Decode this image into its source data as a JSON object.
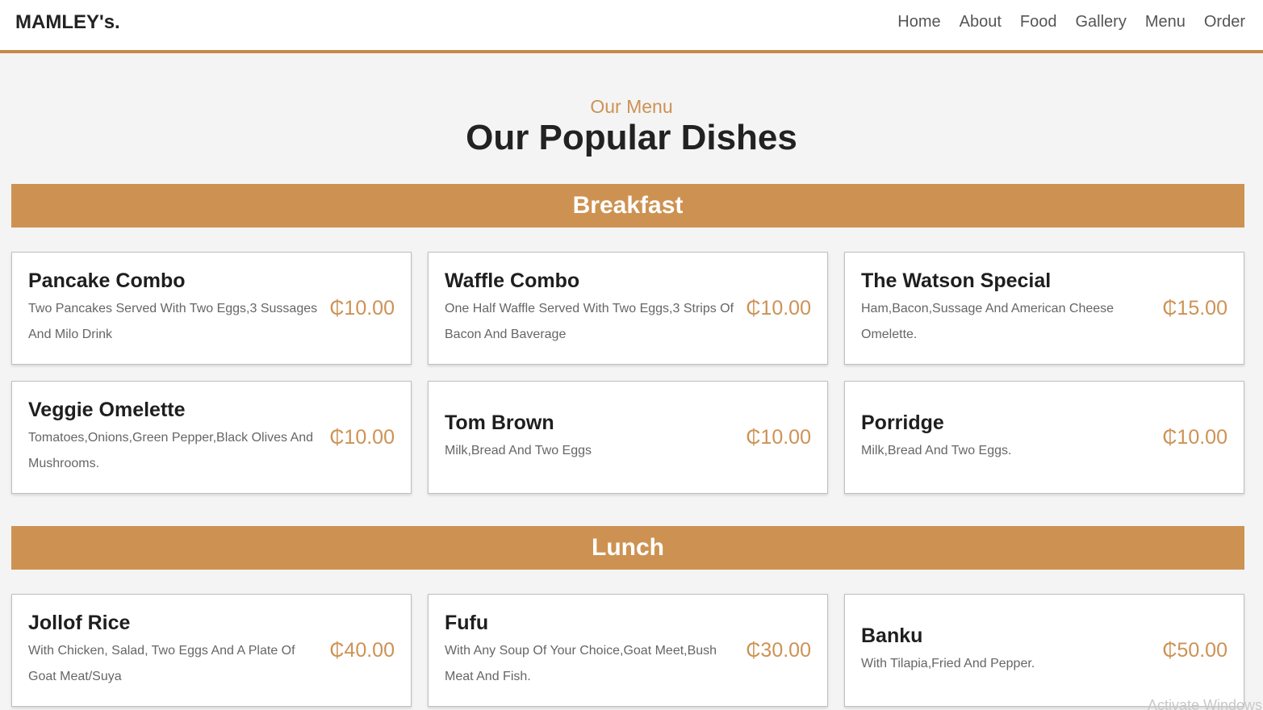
{
  "header": {
    "logo": "MAMLEY's.",
    "nav": [
      "Home",
      "About",
      "Food",
      "Gallery",
      "Menu",
      "Order"
    ]
  },
  "section": {
    "subtitle": "Our Menu",
    "title": "Our Popular Dishes"
  },
  "breakfast": {
    "heading": "Breakfast",
    "items": [
      {
        "name": "Pancake Combo",
        "desc": "Two Pancakes Served With Two Eggs,3 Sussages And Milo Drink",
        "price": "₵10.00"
      },
      {
        "name": "Waffle Combo",
        "desc": "One Half Waffle Served With Two Eggs,3 Strips Of Bacon And Baverage",
        "price": "₵10.00"
      },
      {
        "name": "The Watson Special",
        "desc": "Ham,Bacon,Sussage And American Cheese Omelette.",
        "price": "₵15.00"
      },
      {
        "name": "Veggie Omelette",
        "desc": "Tomatoes,Onions,Green Pepper,Black Olives And Mushrooms.",
        "price": "₵10.00"
      },
      {
        "name": "Tom Brown",
        "desc": "Milk,Bread And Two Eggs",
        "price": "₵10.00"
      },
      {
        "name": "Porridge",
        "desc": "Milk,Bread And Two Eggs.",
        "price": "₵10.00"
      }
    ]
  },
  "lunch": {
    "heading": "Lunch",
    "items": [
      {
        "name": "Jollof Rice",
        "desc": "With Chicken, Salad, Two Eggs And A Plate Of Goat Meat/Suya",
        "price": "₵40.00"
      },
      {
        "name": "Fufu",
        "desc": "With Any Soup Of Your Choice,Goat Meet,Bush Meat And Fish.",
        "price": "₵30.00"
      },
      {
        "name": "Banku",
        "desc": "With Tilapia,Fried And Pepper.",
        "price": "₵50.00"
      }
    ]
  },
  "overlay": {
    "watermark": "Activate Windows"
  },
  "colors": {
    "accent": "#cd9252",
    "header_border": "#c8894a",
    "background": "#f4f4f4"
  }
}
